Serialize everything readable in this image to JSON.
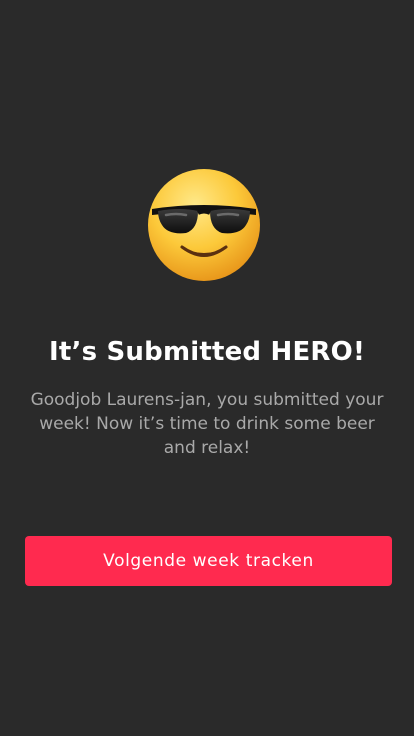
{
  "hero": {
    "emoji_icon": "smiling-face-with-sunglasses",
    "title": "It’s Submitted HERO!",
    "message": "Goodjob Laurens-jan, you submitted your week! Now it’s time to drink some beer and relax!"
  },
  "actions": {
    "primary_label": "Volgende week tracken"
  },
  "colors": {
    "background": "#2a2a2a",
    "title": "#ffffff",
    "message": "#a9a9a9",
    "accent": "#ff2a4f"
  }
}
